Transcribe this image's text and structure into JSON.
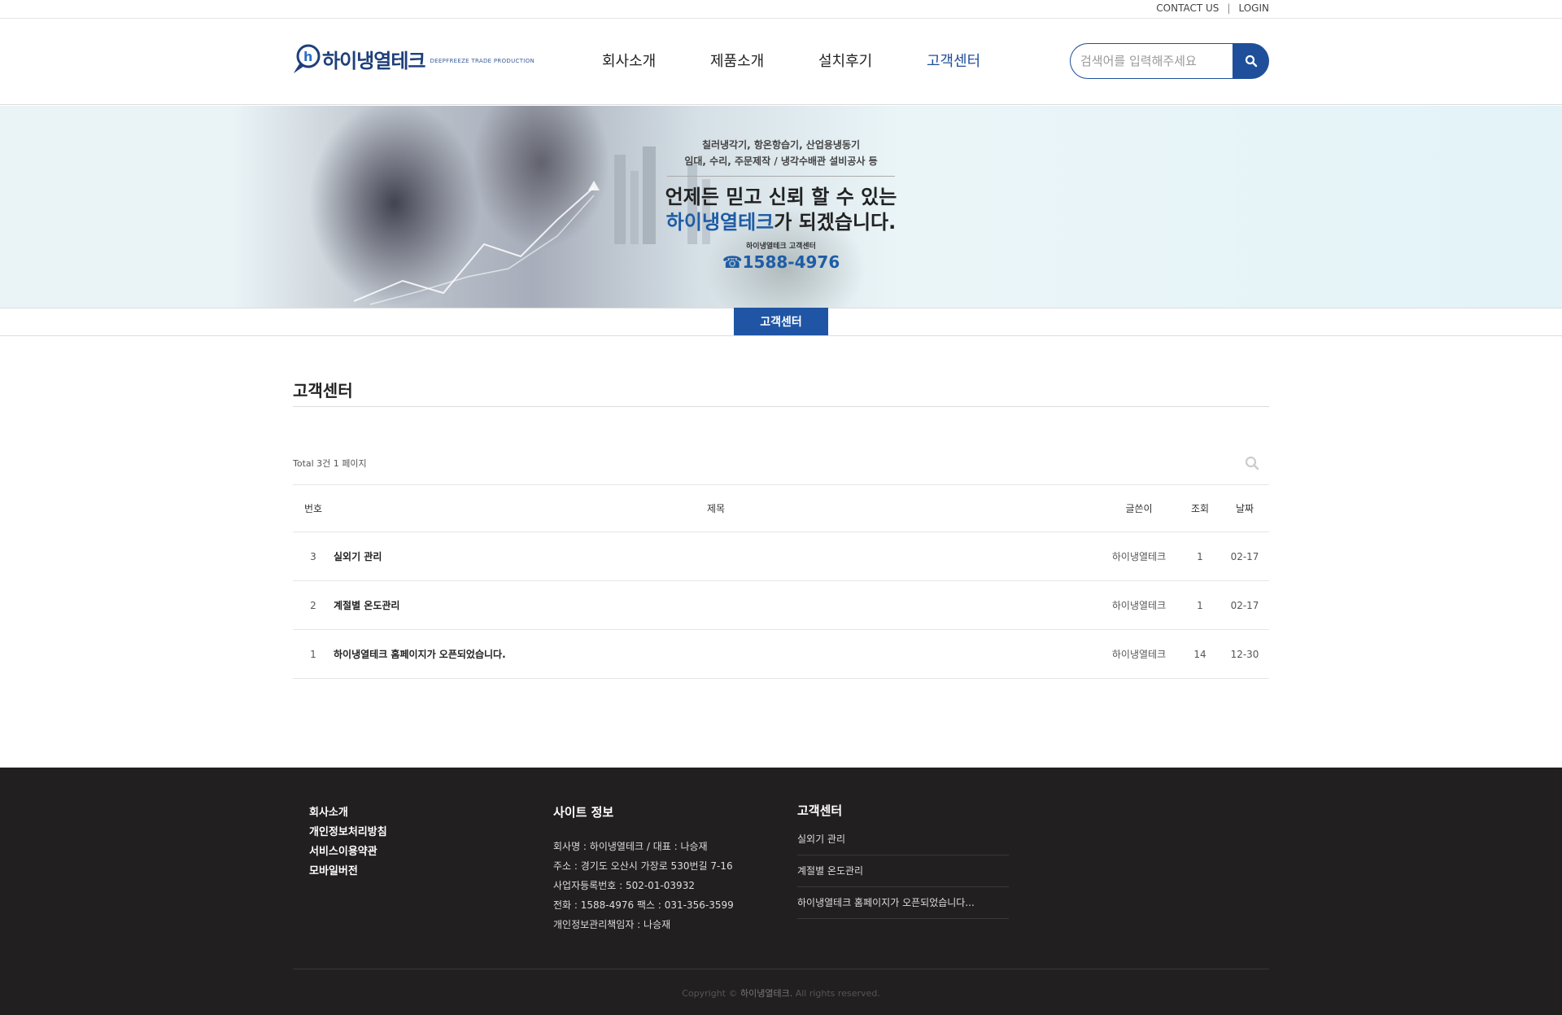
{
  "topbar": {
    "contact": "CONTACT US",
    "sep": "|",
    "login": "LOGIN"
  },
  "header": {
    "logo_text": "하이냉열테크",
    "logo_sub": "DEEPFREEZE TRADE PRODUCTION",
    "nav": [
      {
        "label": "회사소개",
        "active": false
      },
      {
        "label": "제품소개",
        "active": false
      },
      {
        "label": "설치후기",
        "active": false
      },
      {
        "label": "고객센터",
        "active": true
      }
    ],
    "search_placeholder": "검색어를 입력해주세요"
  },
  "banner": {
    "line1": "칠러냉각기, 항온항습기, 산업용냉동기",
    "line2": "임대, 수리, 주문제작 / 냉각수배관 설비공사 등",
    "big1": "언제든 믿고 신뢰 할 수 있는",
    "big2_hl": "하이냉열테크",
    "big2_rest": "가 되겠습니다.",
    "cc_label": "하이냉열테크 고객센터",
    "phone": "☎1588-4976"
  },
  "subtab": {
    "label": "고객센터"
  },
  "board": {
    "title": "고객센터",
    "total": "Total 3건 1 페이지",
    "headers": {
      "num": "번호",
      "subject": "제목",
      "writer": "글쓴이",
      "hit": "조회",
      "date": "날짜"
    },
    "rows": [
      {
        "num": "3",
        "subject": "실외기 관리",
        "writer": "하이냉열테크",
        "hit": "1",
        "date": "02-17"
      },
      {
        "num": "2",
        "subject": "계절별 온도관리",
        "writer": "하이냉열테크",
        "hit": "1",
        "date": "02-17"
      },
      {
        "num": "1",
        "subject": "하이냉열테크 홈페이지가 오픈되었습니다.",
        "writer": "하이냉열테크",
        "hit": "14",
        "date": "12-30"
      }
    ]
  },
  "footer": {
    "links": [
      "회사소개",
      "개인정보처리방침",
      "서비스이용약관",
      "모바일버전"
    ],
    "site_info_title": "사이트 정보",
    "site_info": [
      "회사명 : 하이냉열테크 / 대표 : 나승재",
      "주소 : 경기도 오산시 가장로 530번길 7-16",
      "사업자등록번호 : 502-01-03932",
      "전화 : 1588-4976 팩스 : 031-356-3599",
      "개인정보관리책임자 : 나승재"
    ],
    "cs_title": "고객센터",
    "cs_posts": [
      "실외기 관리",
      "계절별 온도관리",
      "하이냉열테크 홈페이지가 오픈되었습니다..."
    ],
    "copyright_pre": "Copyright ©",
    "copyright_brand": "하이냉열테크.",
    "copyright_post": "All rights reserved."
  },
  "colors": {
    "brand_blue": "#1f4f9a",
    "footer_bg": "#221f20"
  }
}
